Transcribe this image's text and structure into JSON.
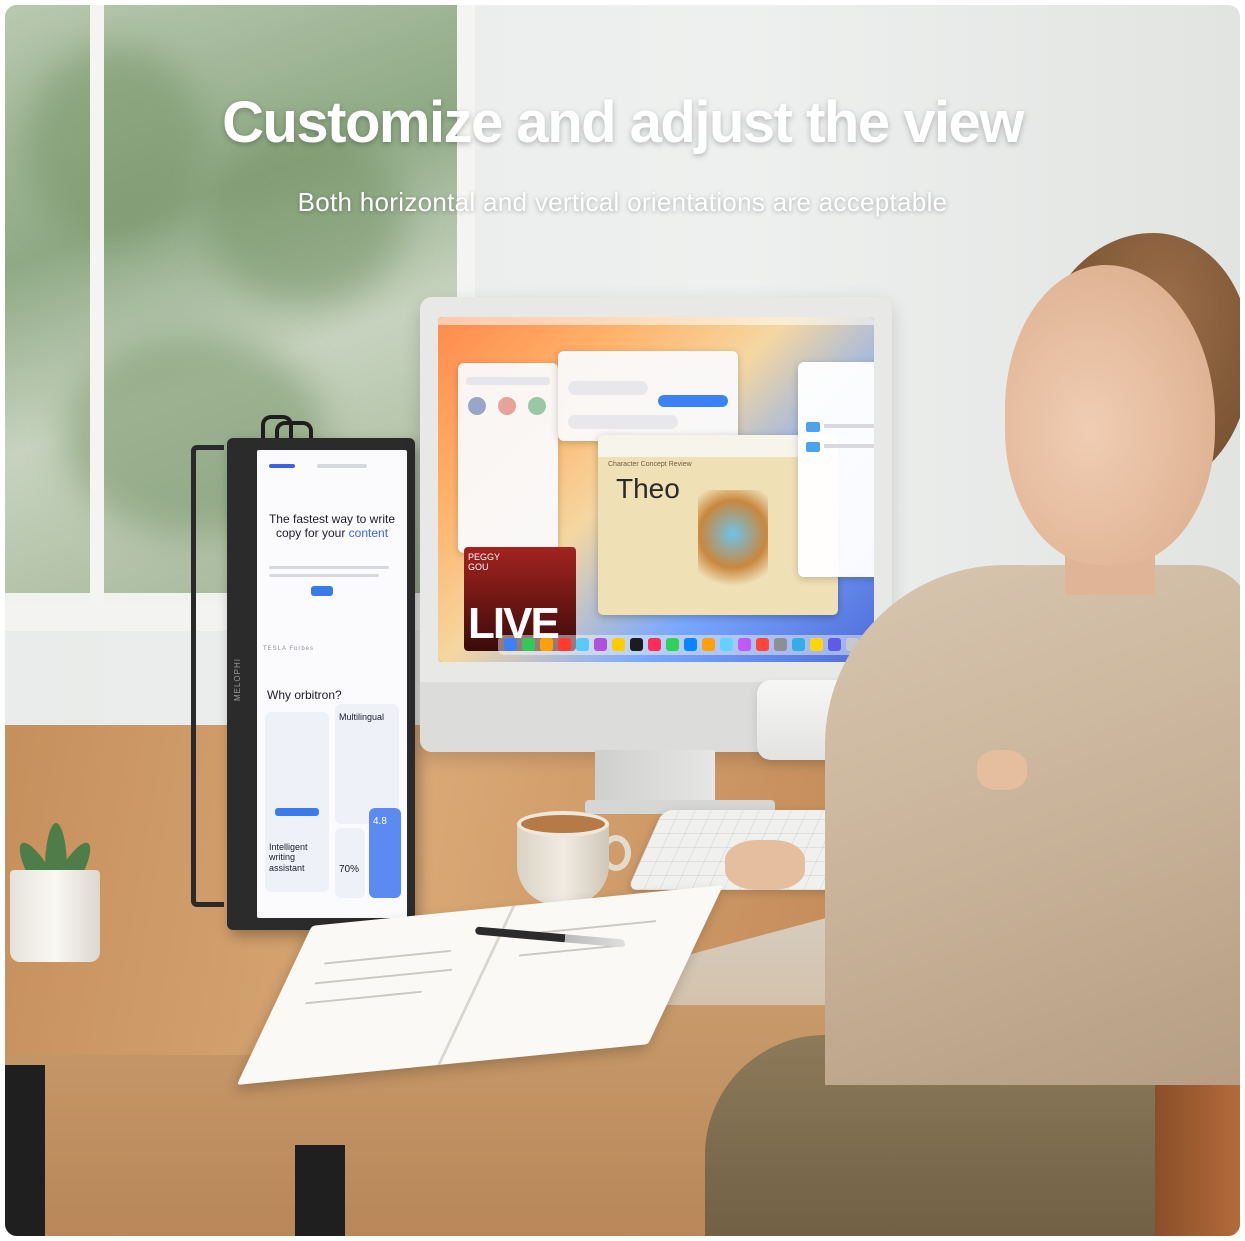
{
  "headline": {
    "title": "Customize and adjust the view",
    "subtitle": "Both horizontal and vertical orientations are acceptable"
  },
  "portable_monitor": {
    "brand": "MELOPHI",
    "headline_part1": "The fastest way to write copy for your",
    "headline_accent": "content",
    "logos": "TESLA  Forbes",
    "section_title": "Why orbitron?",
    "card_title": "Multilingual",
    "card_title_2": "Intelligent writing assistant",
    "stat_1": "4.8",
    "stat_2": "70%"
  },
  "imac_screen": {
    "video_tile_line1": "PEGGY",
    "video_tile_line2": "GOU",
    "video_tile_live": "LIVE",
    "design_window_heading": "Character Concept Review",
    "design_window_title": "Theo"
  },
  "colors": {
    "title_text": "#ffffff",
    "accent_blue": "#3b62e8",
    "wood": "#c58f5c"
  }
}
